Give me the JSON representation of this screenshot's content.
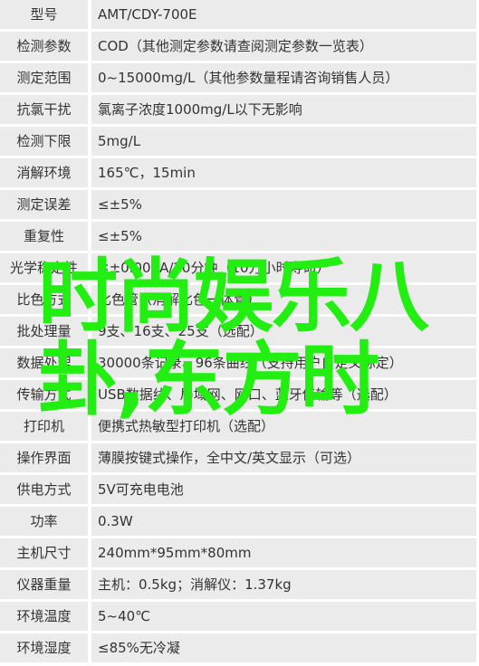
{
  "specs": [
    {
      "k": "型号",
      "v": "AMT/CDY-700E"
    },
    {
      "k": "检测参数",
      "v": "COD（其他测定参数请查阅测定参数一览表）"
    },
    {
      "k": "测定范围",
      "v": "0~15000mg/L（其他参数量程请咨询销售人员）"
    },
    {
      "k": "抗氯干扰",
      "v": "氯离子浓度1000mg/L以下无影响"
    },
    {
      "k": "检测下限",
      "v": "5mg/L"
    },
    {
      "k": "消解环境",
      "v": "165℃，15min"
    },
    {
      "k": "测定误差",
      "v": "≤±5%"
    },
    {
      "k": "重复性",
      "v": "≤±5%"
    },
    {
      "k": "光学稳定性",
      "v": "≤±0.001A/20分钟（10万小时寿命）"
    },
    {
      "k": "比色方式",
      "v": "比色管（消解比色一体管）"
    },
    {
      "k": "批处理量",
      "v": "9支、16支、25支（选配）"
    },
    {
      "k": "数据处理",
      "v": "30000条记录、96条曲线（支持用户自定义标定）"
    },
    {
      "k": "传输方式",
      "v": "USB数据线、局域网、网口、蓝牙传输等（选配）"
    },
    {
      "k": "打印机",
      "v": "便携式热敏型打印机（选配）"
    },
    {
      "k": "操作界面",
      "v": "薄膜按键式操作，全中文/英文显示（可选）"
    },
    {
      "k": "供电方式",
      "v": "5V可充电电池"
    },
    {
      "k": "功率",
      "v": "0.3W"
    },
    {
      "k": "主机尺寸",
      "v": "240mm*95mm*80mm"
    },
    {
      "k": "仪器重量",
      "v": "主机：0.5kg；消解仪：1.37kg"
    },
    {
      "k": "环境温度",
      "v": "5~40℃"
    },
    {
      "k": "环境湿度",
      "v": "≤85%无冷凝"
    }
  ],
  "overlay": {
    "line1": "时尚娱乐八",
    "line2": "卦,东方时",
    "color": "#22ee11"
  }
}
